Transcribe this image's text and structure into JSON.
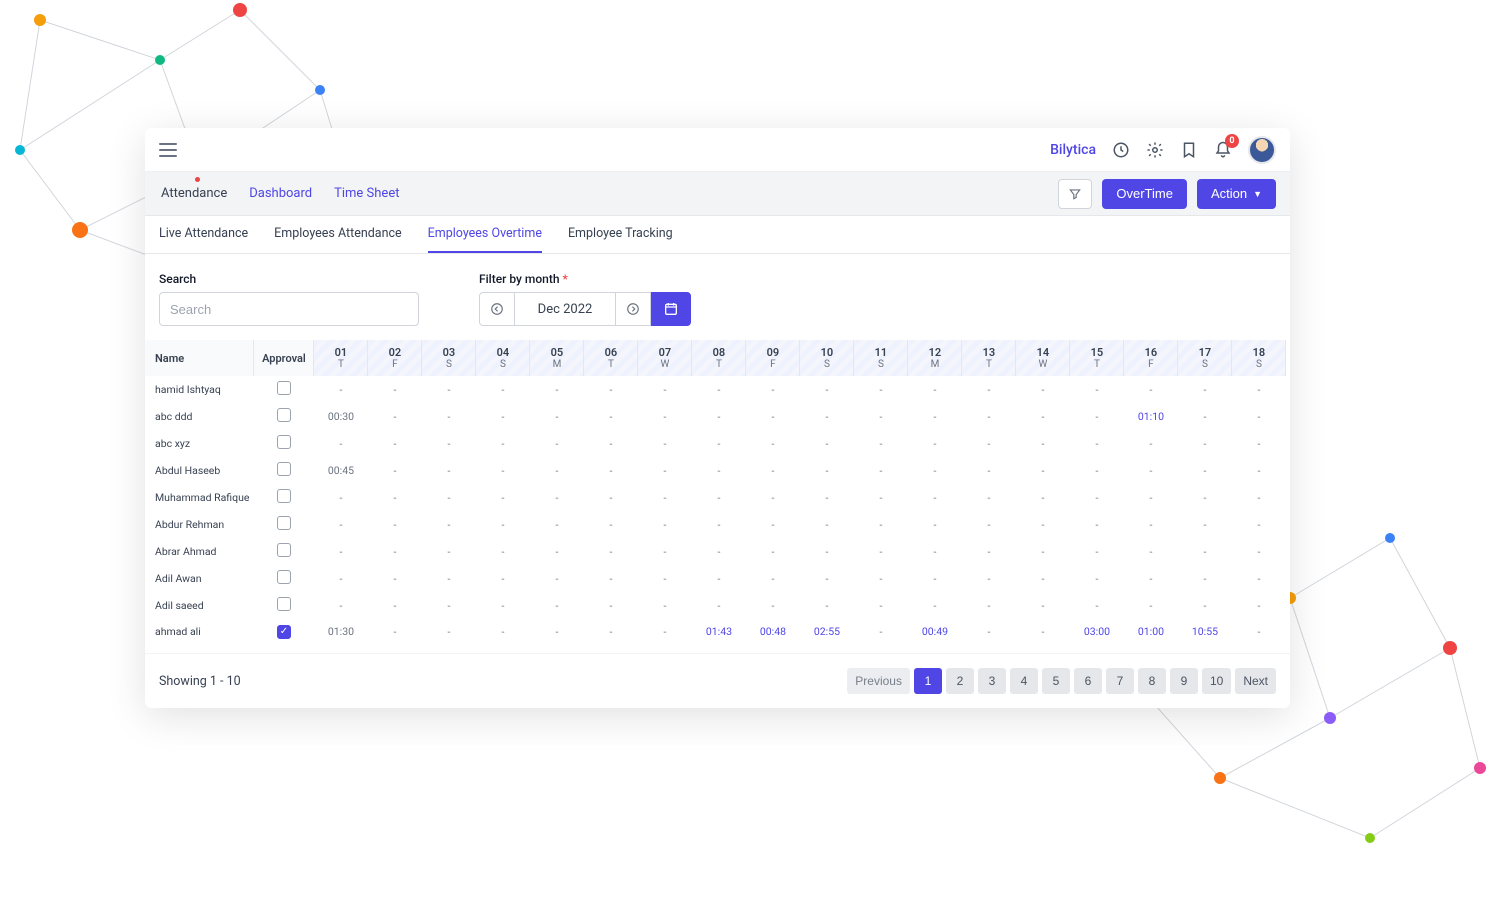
{
  "header": {
    "brand": "Bilytica",
    "notification_count": "0"
  },
  "subbar": {
    "tabs": [
      "Attendance",
      "Dashboard",
      "Time Sheet"
    ],
    "active": "Attendance",
    "overtime_label": "OverTime",
    "action_label": "Action"
  },
  "tabs2": {
    "items": [
      "Live Attendance",
      "Employees Attendance",
      "Employees Overtime",
      "Employee Tracking"
    ],
    "active": "Employees Overtime"
  },
  "filters": {
    "search_label": "Search",
    "search_placeholder": "Search",
    "month_label": "Filter by month",
    "month_value": "Dec 2022"
  },
  "table": {
    "name_header": "Name",
    "approval_header": "Approval",
    "days": [
      {
        "num": "01",
        "dw": "T"
      },
      {
        "num": "02",
        "dw": "F"
      },
      {
        "num": "03",
        "dw": "S"
      },
      {
        "num": "04",
        "dw": "S"
      },
      {
        "num": "05",
        "dw": "M"
      },
      {
        "num": "06",
        "dw": "T"
      },
      {
        "num": "07",
        "dw": "W"
      },
      {
        "num": "08",
        "dw": "T"
      },
      {
        "num": "09",
        "dw": "F"
      },
      {
        "num": "10",
        "dw": "S"
      },
      {
        "num": "11",
        "dw": "S"
      },
      {
        "num": "12",
        "dw": "M"
      },
      {
        "num": "13",
        "dw": "T"
      },
      {
        "num": "14",
        "dw": "W"
      },
      {
        "num": "15",
        "dw": "T"
      },
      {
        "num": "16",
        "dw": "F"
      },
      {
        "num": "17",
        "dw": "S"
      },
      {
        "num": "18",
        "dw": "S"
      }
    ],
    "rows": [
      {
        "name": "hamid Ishtyaq",
        "approved": false,
        "cells": [
          "-",
          "-",
          "-",
          "-",
          "-",
          "-",
          "-",
          "-",
          "-",
          "-",
          "-",
          "-",
          "-",
          "-",
          "-",
          "-",
          "-",
          "-"
        ],
        "blue": []
      },
      {
        "name": "abc ddd",
        "approved": false,
        "cells": [
          "00:30",
          "-",
          "-",
          "-",
          "-",
          "-",
          "-",
          "-",
          "-",
          "-",
          "-",
          "-",
          "-",
          "-",
          "-",
          "01:10",
          "-",
          "-"
        ],
        "blue": [
          15
        ]
      },
      {
        "name": "abc xyz",
        "approved": false,
        "cells": [
          "-",
          "-",
          "-",
          "-",
          "-",
          "-",
          "-",
          "-",
          "-",
          "-",
          "-",
          "-",
          "-",
          "-",
          "-",
          "-",
          "-",
          "-"
        ],
        "blue": []
      },
      {
        "name": "Abdul Haseeb",
        "approved": false,
        "cells": [
          "00:45",
          "-",
          "-",
          "-",
          "-",
          "-",
          "-",
          "-",
          "-",
          "-",
          "-",
          "-",
          "-",
          "-",
          "-",
          "-",
          "-",
          "-"
        ],
        "blue": []
      },
      {
        "name": "Muhammad Rafique",
        "approved": false,
        "cells": [
          "-",
          "-",
          "-",
          "-",
          "-",
          "-",
          "-",
          "-",
          "-",
          "-",
          "-",
          "-",
          "-",
          "-",
          "-",
          "-",
          "-",
          "-"
        ],
        "blue": []
      },
      {
        "name": "Abdur Rehman",
        "approved": false,
        "cells": [
          "-",
          "-",
          "-",
          "-",
          "-",
          "-",
          "-",
          "-",
          "-",
          "-",
          "-",
          "-",
          "-",
          "-",
          "-",
          "-",
          "-",
          "-"
        ],
        "blue": []
      },
      {
        "name": "Abrar Ahmad",
        "approved": false,
        "cells": [
          "-",
          "-",
          "-",
          "-",
          "-",
          "-",
          "-",
          "-",
          "-",
          "-",
          "-",
          "-",
          "-",
          "-",
          "-",
          "-",
          "-",
          "-"
        ],
        "blue": []
      },
      {
        "name": "Adil Awan",
        "approved": false,
        "cells": [
          "-",
          "-",
          "-",
          "-",
          "-",
          "-",
          "-",
          "-",
          "-",
          "-",
          "-",
          "-",
          "-",
          "-",
          "-",
          "-",
          "-",
          "-"
        ],
        "blue": []
      },
      {
        "name": "Adil saeed",
        "approved": false,
        "cells": [
          "-",
          "-",
          "-",
          "-",
          "-",
          "-",
          "-",
          "-",
          "-",
          "-",
          "-",
          "-",
          "-",
          "-",
          "-",
          "-",
          "-",
          "-"
        ],
        "blue": []
      },
      {
        "name": "ahmad ali",
        "approved": true,
        "cells": [
          "01:30",
          "-",
          "-",
          "-",
          "-",
          "-",
          "-",
          "01:43",
          "00:48",
          "02:55",
          "-",
          "00:49",
          "-",
          "-",
          "03:00",
          "01:00",
          "10:55",
          "-"
        ],
        "blue": [
          7,
          8,
          9,
          11,
          14,
          15,
          16
        ]
      }
    ]
  },
  "footer": {
    "showing": "Showing 1 - 10",
    "prev": "Previous",
    "next": "Next",
    "pages": [
      "1",
      "2",
      "3",
      "4",
      "5",
      "6",
      "7",
      "8",
      "9",
      "10"
    ],
    "current": "1"
  }
}
